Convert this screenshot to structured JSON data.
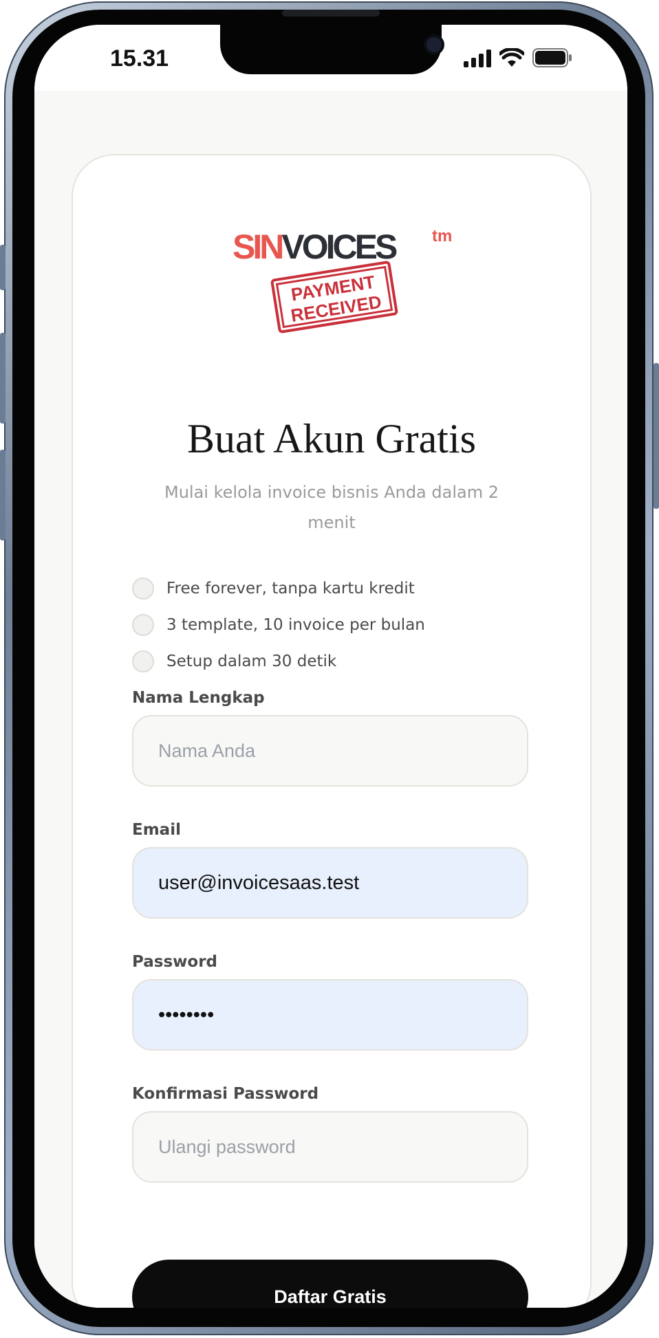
{
  "status_bar": {
    "time": "15.31",
    "icons": [
      "signal-icon",
      "wifi-icon",
      "battery-icon"
    ]
  },
  "logo": {
    "brand_part1": "SIN",
    "brand_part2": "VOICES",
    "trademark": "tm",
    "stamp_line1": "PAYMENT",
    "stamp_line2": "RECEIVED"
  },
  "header": {
    "title": "Buat Akun Gratis",
    "subtitle": "Mulai kelola invoice bisnis Anda dalam 2 menit"
  },
  "features": [
    {
      "text": "Free forever, tanpa kartu kredit"
    },
    {
      "text": "3 template, 10 invoice per bulan"
    },
    {
      "text": "Setup dalam 30 detik"
    }
  ],
  "form": {
    "name": {
      "label": "Nama Lengkap",
      "placeholder": "Nama Anda",
      "value": ""
    },
    "email": {
      "label": "Email",
      "value": "user@invoicesaas.test"
    },
    "password": {
      "label": "Password",
      "value": "••••••••"
    },
    "confirm_password": {
      "label": "Konfirmasi Password",
      "placeholder": "Ulangi password",
      "value": ""
    },
    "submit_label": "Daftar Gratis"
  },
  "colors": {
    "brand_red": "#e8574f",
    "brand_dark": "#2c3036",
    "stamp_red": "#c9303a",
    "autofill_bg": "#e8effd",
    "button_bg": "#0c0c0c"
  }
}
